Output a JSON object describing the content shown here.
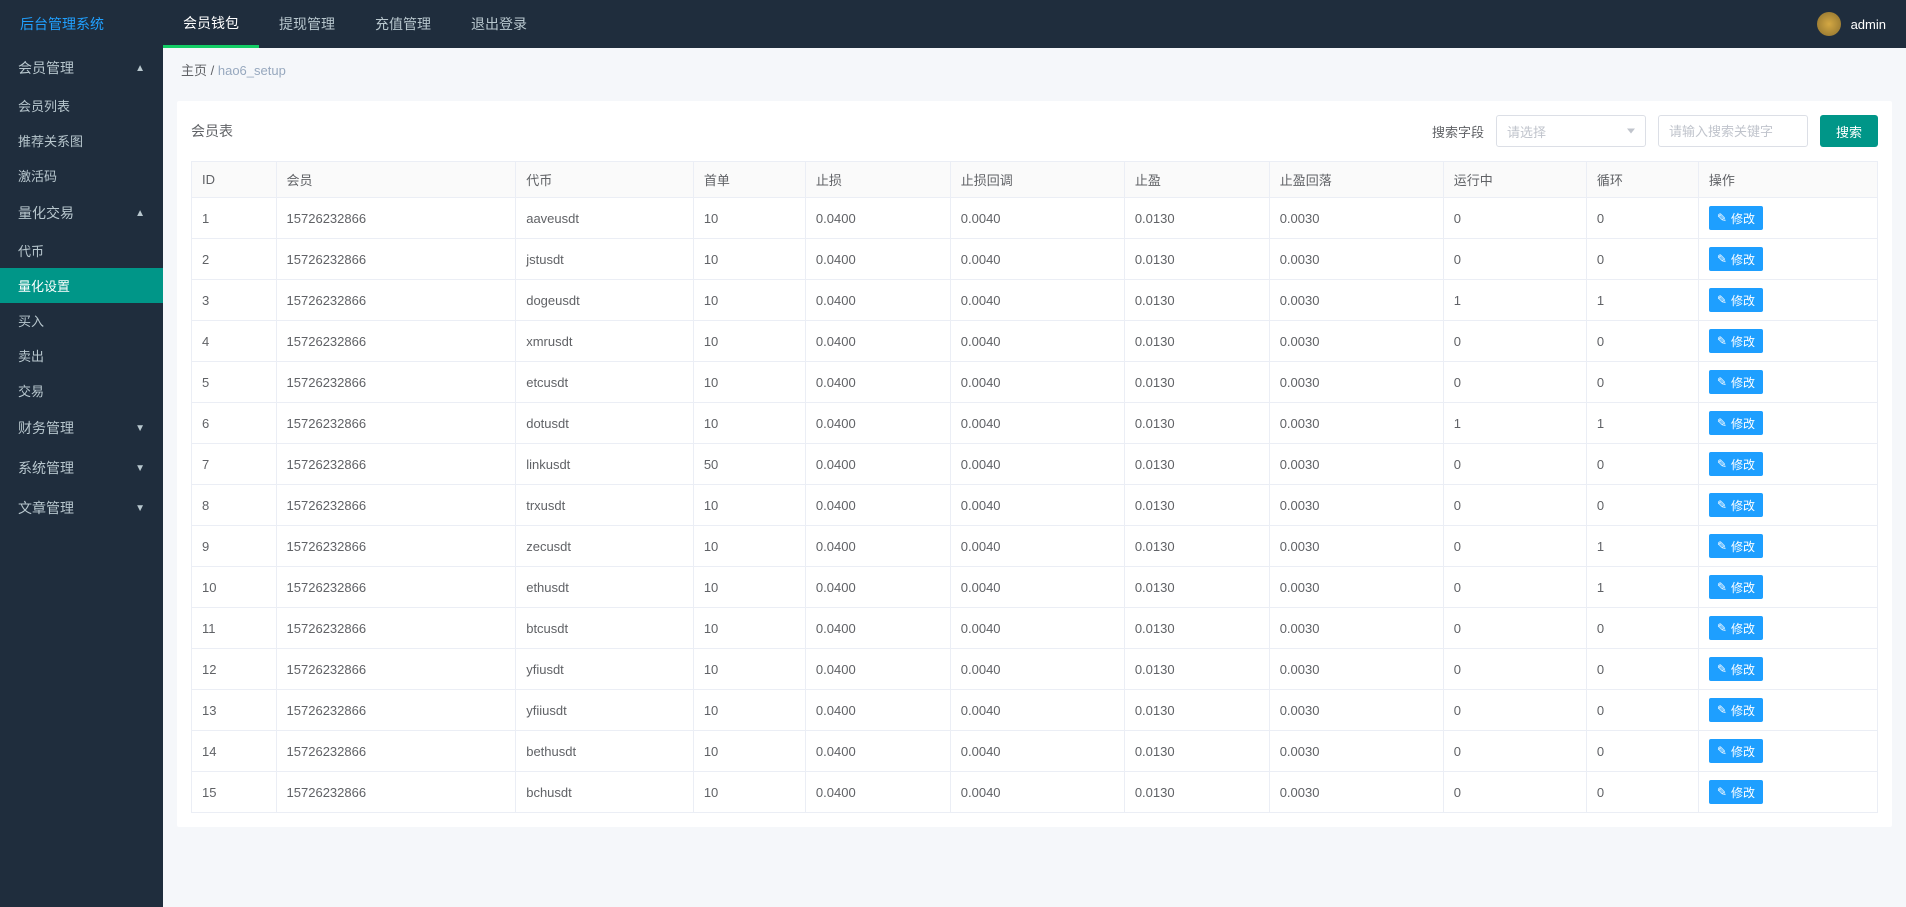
{
  "logo": "后台管理系统",
  "topnav": [
    "会员钱包",
    "提现管理",
    "充值管理",
    "退出登录"
  ],
  "topnav_active": 0,
  "user": "admin",
  "sidebar": [
    {
      "label": "会员管理",
      "type": "header",
      "open": true
    },
    {
      "label": "会员列表",
      "type": "item"
    },
    {
      "label": "推荐关系图",
      "type": "item"
    },
    {
      "label": "激活码",
      "type": "item"
    },
    {
      "label": "量化交易",
      "type": "header",
      "open": true
    },
    {
      "label": "代币",
      "type": "item"
    },
    {
      "label": "量化设置",
      "type": "item",
      "active": true
    },
    {
      "label": "买入",
      "type": "item"
    },
    {
      "label": "卖出",
      "type": "item"
    },
    {
      "label": "交易",
      "type": "item"
    },
    {
      "label": "财务管理",
      "type": "header",
      "open": false
    },
    {
      "label": "系统管理",
      "type": "header",
      "open": false
    },
    {
      "label": "文章管理",
      "type": "header",
      "open": false
    }
  ],
  "breadcrumb": {
    "home": "主页",
    "sep": " / ",
    "current": "hao6_setup"
  },
  "panel": {
    "title": "会员表",
    "search_label": "搜索字段",
    "select_placeholder": "请选择",
    "input_placeholder": "请输入搜索关键字",
    "search_btn": "搜索"
  },
  "columns": [
    "ID",
    "会员",
    "代币",
    "首单",
    "止损",
    "止损回调",
    "止盈",
    "止盈回落",
    "运行中",
    "循环",
    "操作"
  ],
  "edit_label": "修改",
  "rows": [
    {
      "id": "1",
      "member": "15726232866",
      "coin": "aaveusdt",
      "first": "10",
      "stop": "0.0400",
      "stop_cb": "0.0040",
      "take": "0.0130",
      "take_cb": "0.0030",
      "run": "0",
      "loop": "0"
    },
    {
      "id": "2",
      "member": "15726232866",
      "coin": "jstusdt",
      "first": "10",
      "stop": "0.0400",
      "stop_cb": "0.0040",
      "take": "0.0130",
      "take_cb": "0.0030",
      "run": "0",
      "loop": "0"
    },
    {
      "id": "3",
      "member": "15726232866",
      "coin": "dogeusdt",
      "first": "10",
      "stop": "0.0400",
      "stop_cb": "0.0040",
      "take": "0.0130",
      "take_cb": "0.0030",
      "run": "1",
      "loop": "1"
    },
    {
      "id": "4",
      "member": "15726232866",
      "coin": "xmrusdt",
      "first": "10",
      "stop": "0.0400",
      "stop_cb": "0.0040",
      "take": "0.0130",
      "take_cb": "0.0030",
      "run": "0",
      "loop": "0"
    },
    {
      "id": "5",
      "member": "15726232866",
      "coin": "etcusdt",
      "first": "10",
      "stop": "0.0400",
      "stop_cb": "0.0040",
      "take": "0.0130",
      "take_cb": "0.0030",
      "run": "0",
      "loop": "0"
    },
    {
      "id": "6",
      "member": "15726232866",
      "coin": "dotusdt",
      "first": "10",
      "stop": "0.0400",
      "stop_cb": "0.0040",
      "take": "0.0130",
      "take_cb": "0.0030",
      "run": "1",
      "loop": "1"
    },
    {
      "id": "7",
      "member": "15726232866",
      "coin": "linkusdt",
      "first": "50",
      "stop": "0.0400",
      "stop_cb": "0.0040",
      "take": "0.0130",
      "take_cb": "0.0030",
      "run": "0",
      "loop": "0"
    },
    {
      "id": "8",
      "member": "15726232866",
      "coin": "trxusdt",
      "first": "10",
      "stop": "0.0400",
      "stop_cb": "0.0040",
      "take": "0.0130",
      "take_cb": "0.0030",
      "run": "0",
      "loop": "0"
    },
    {
      "id": "9",
      "member": "15726232866",
      "coin": "zecusdt",
      "first": "10",
      "stop": "0.0400",
      "stop_cb": "0.0040",
      "take": "0.0130",
      "take_cb": "0.0030",
      "run": "0",
      "loop": "1"
    },
    {
      "id": "10",
      "member": "15726232866",
      "coin": "ethusdt",
      "first": "10",
      "stop": "0.0400",
      "stop_cb": "0.0040",
      "take": "0.0130",
      "take_cb": "0.0030",
      "run": "0",
      "loop": "1"
    },
    {
      "id": "11",
      "member": "15726232866",
      "coin": "btcusdt",
      "first": "10",
      "stop": "0.0400",
      "stop_cb": "0.0040",
      "take": "0.0130",
      "take_cb": "0.0030",
      "run": "0",
      "loop": "0"
    },
    {
      "id": "12",
      "member": "15726232866",
      "coin": "yfiusdt",
      "first": "10",
      "stop": "0.0400",
      "stop_cb": "0.0040",
      "take": "0.0130",
      "take_cb": "0.0030",
      "run": "0",
      "loop": "0"
    },
    {
      "id": "13",
      "member": "15726232866",
      "coin": "yfiiusdt",
      "first": "10",
      "stop": "0.0400",
      "stop_cb": "0.0040",
      "take": "0.0130",
      "take_cb": "0.0030",
      "run": "0",
      "loop": "0"
    },
    {
      "id": "14",
      "member": "15726232866",
      "coin": "bethusdt",
      "first": "10",
      "stop": "0.0400",
      "stop_cb": "0.0040",
      "take": "0.0130",
      "take_cb": "0.0030",
      "run": "0",
      "loop": "0"
    },
    {
      "id": "15",
      "member": "15726232866",
      "coin": "bchusdt",
      "first": "10",
      "stop": "0.0400",
      "stop_cb": "0.0040",
      "take": "0.0130",
      "take_cb": "0.0030",
      "run": "0",
      "loop": "0"
    }
  ]
}
